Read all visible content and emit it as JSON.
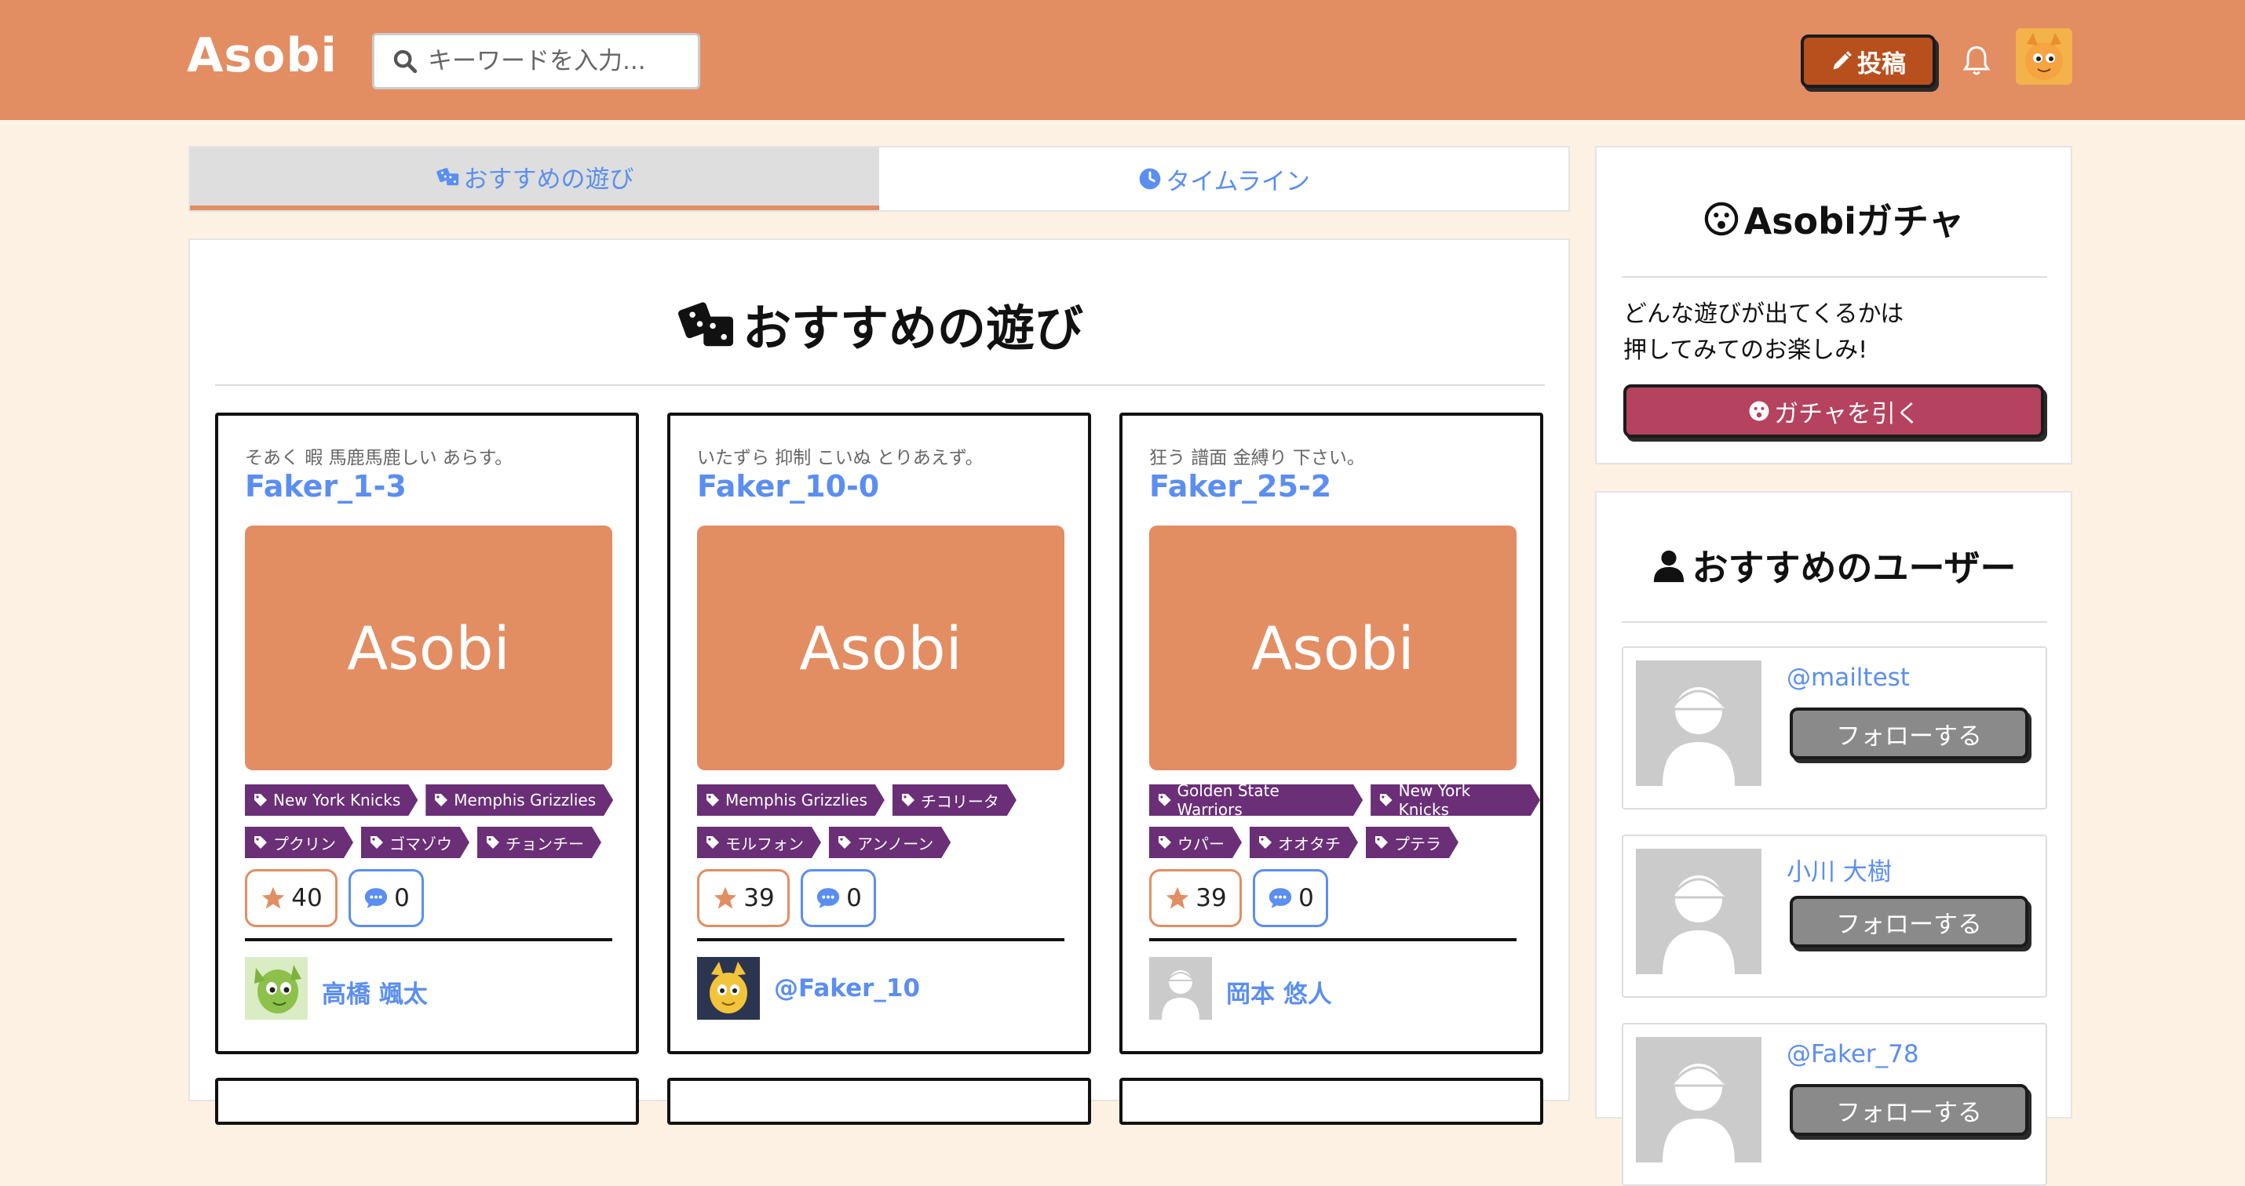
{
  "header": {
    "logo": "Asobi",
    "search_placeholder": "キーワードを入力...",
    "post_label": "投稿"
  },
  "tabs": [
    {
      "label": "おすすめの遊び",
      "icon": "dice-icon",
      "active": true
    },
    {
      "label": "タイムライン",
      "icon": "clock-icon",
      "active": false
    }
  ],
  "main": {
    "title": "おすすめの遊び",
    "thumb_text": "Asobi",
    "cards": [
      {
        "desc": "そあく 暇 馬鹿馬鹿しい あらす。",
        "title": "Faker_1-3",
        "tags_row1": [
          "New York Knicks",
          "Memphis Grizzlies"
        ],
        "tags_row2": [
          "プクリン",
          "ゴマゾウ",
          "チョンチー"
        ],
        "stars": "40",
        "comments": "0",
        "author": "高橋 颯太"
      },
      {
        "desc": "いたずら 抑制 こいぬ とりあえず。",
        "title": "Faker_10-0",
        "tags_row1": [
          "Memphis Grizzlies",
          "チコリータ"
        ],
        "tags_row2": [
          "モルフォン",
          "アンノーン"
        ],
        "stars": "39",
        "comments": "0",
        "author": "@Faker_10"
      },
      {
        "desc": "狂う 譜面 金縛り 下さい。",
        "title": "Faker_25-2",
        "tags_row1": [
          "Golden State Warriors",
          "New York Knicks"
        ],
        "tags_row2": [
          "ウパー",
          "オオタチ",
          "プテラ"
        ],
        "stars": "39",
        "comments": "0",
        "author": "岡本 悠人"
      }
    ]
  },
  "gacha": {
    "title": "Asobiガチャ",
    "text_line1": "どんな遊びが出てくるかは",
    "text_line2": "押してみてのお楽しみ!",
    "button_label": "ガチャを引く"
  },
  "users": {
    "title": "おすすめのユーザー",
    "follow_label": "フォローする",
    "items": [
      {
        "name": "@mailtest"
      },
      {
        "name": "小川 大樹"
      },
      {
        "name": "@Faker_78"
      }
    ]
  },
  "colors": {
    "header": "#e38d63",
    "accent_blue": "#5b8ef0",
    "tag": "#6a2f77",
    "post_button": "#b8501e",
    "gacha_button": "#b5425e",
    "follow_button": "#8a8a8a",
    "background": "#fdf1e3"
  }
}
